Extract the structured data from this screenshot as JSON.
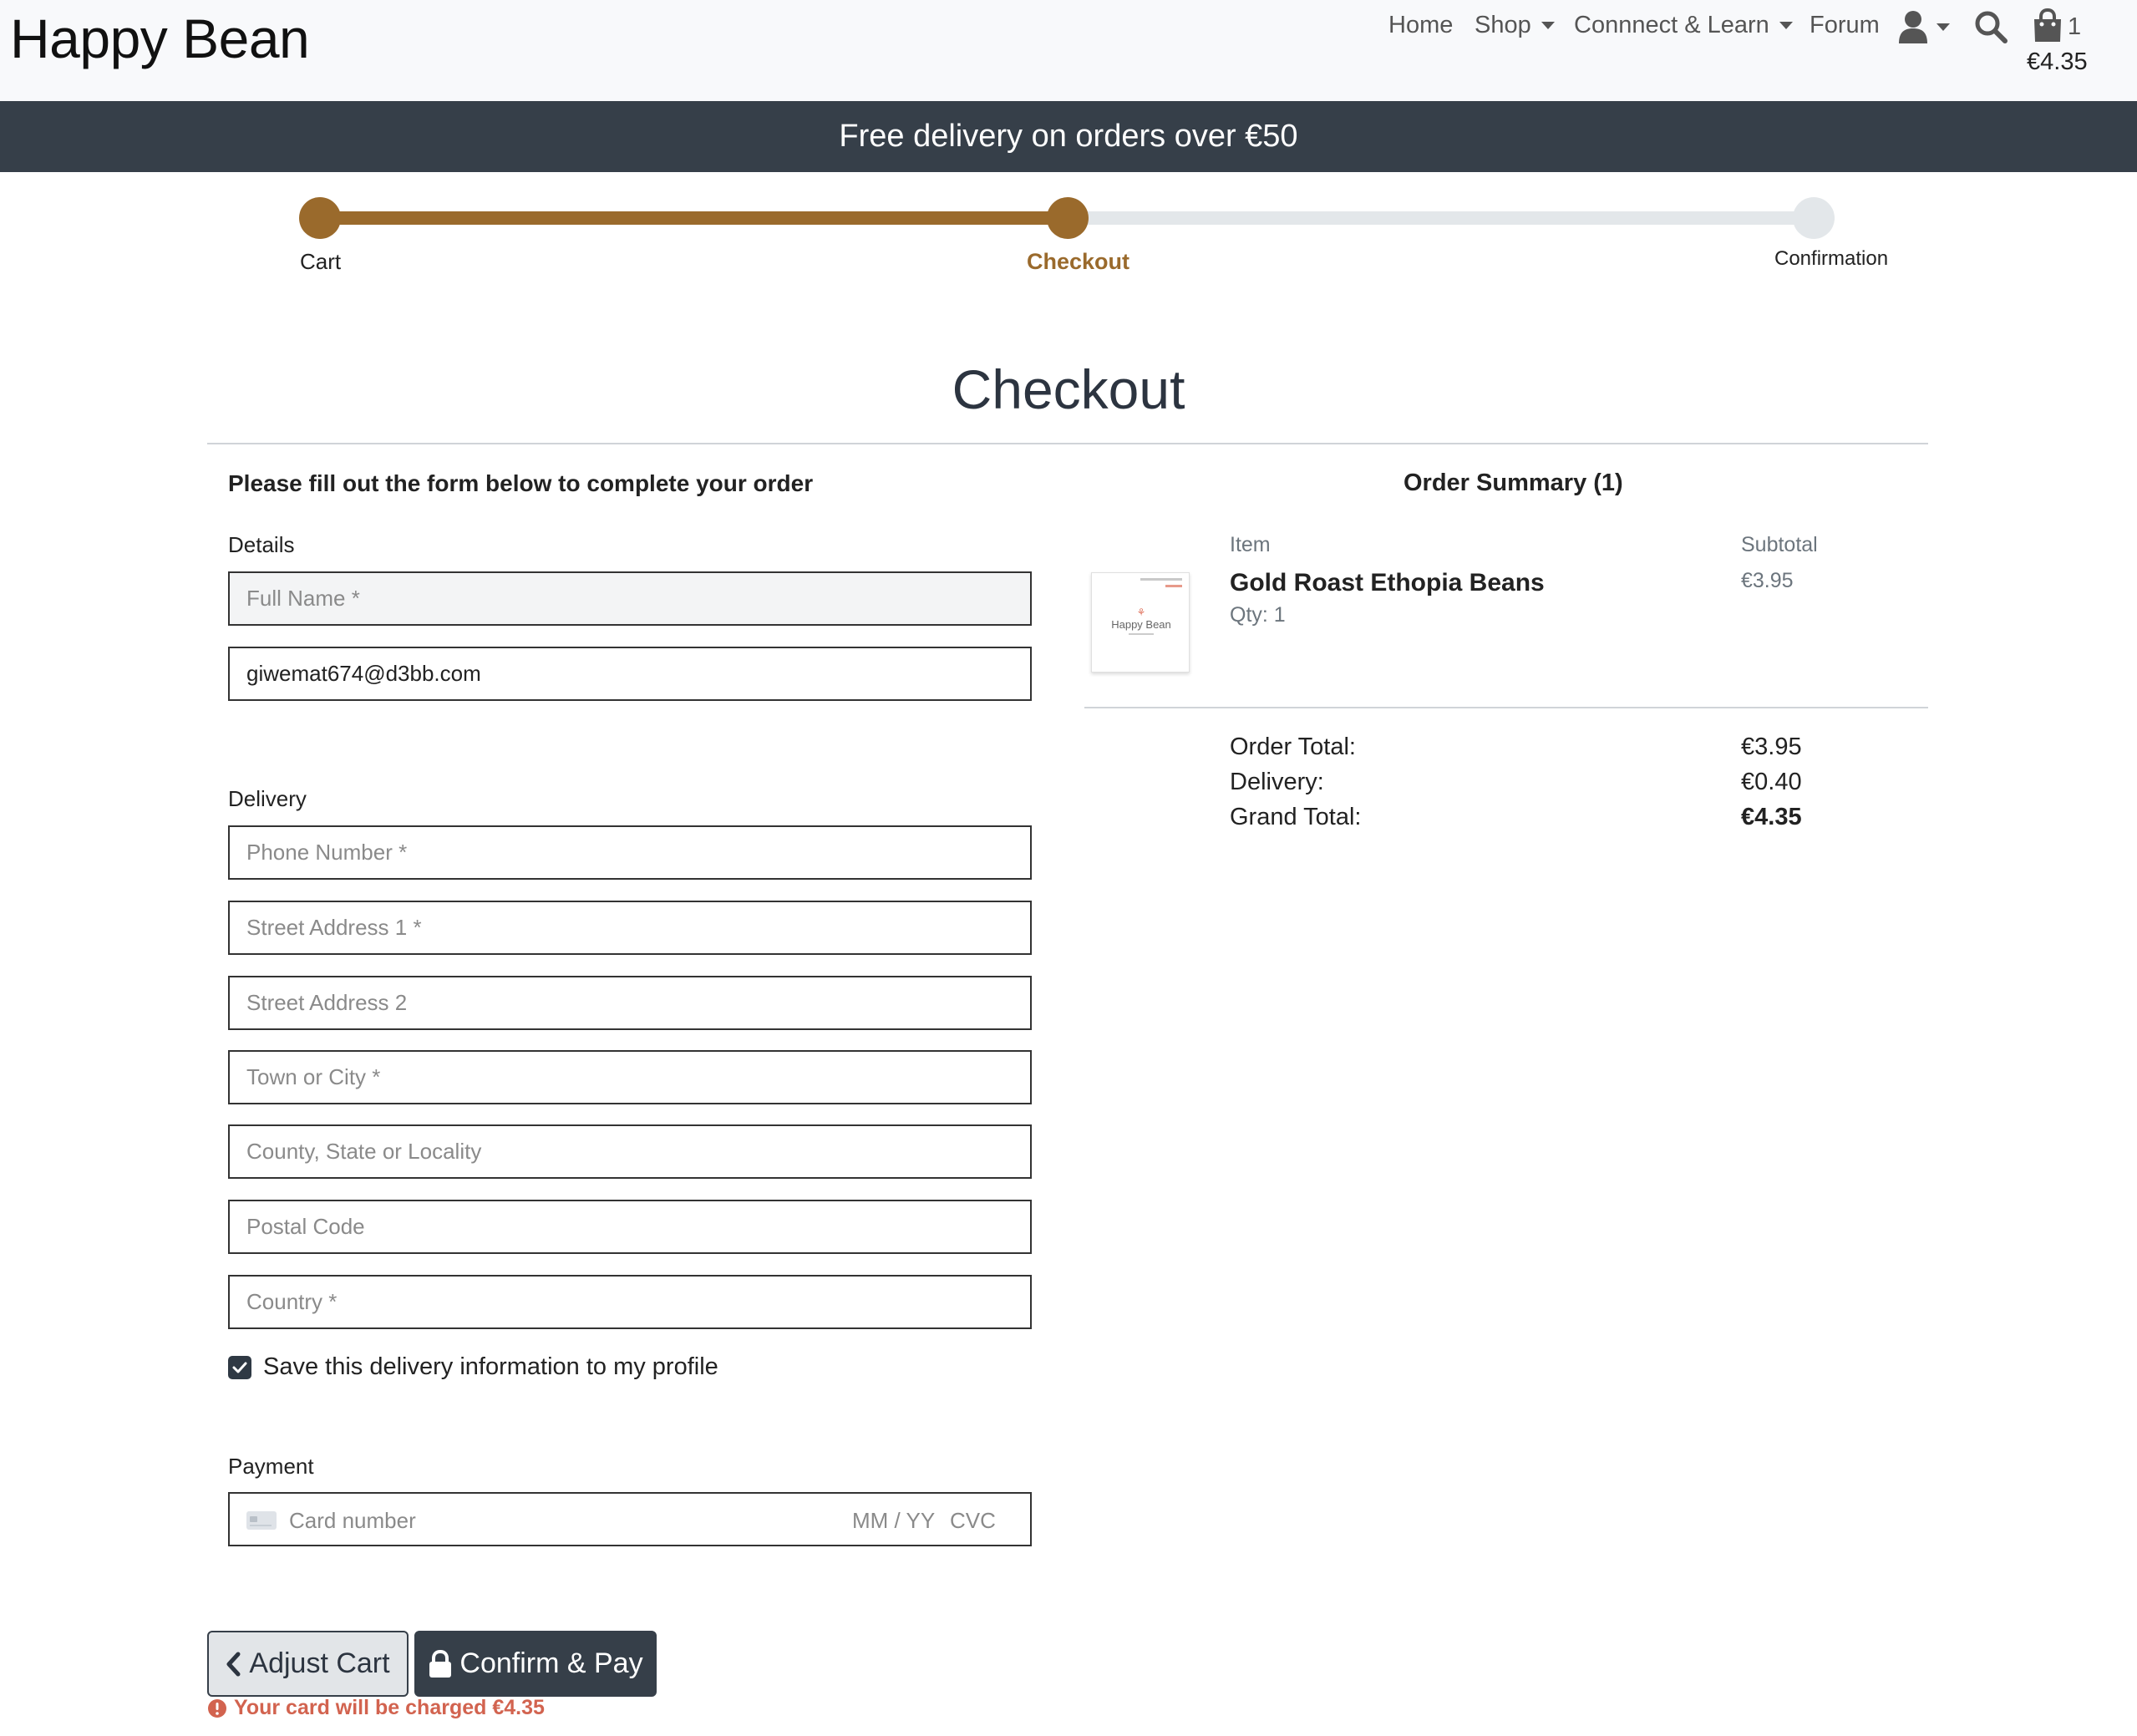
{
  "header": {
    "brand": "Happy Bean",
    "nav": {
      "home": "Home",
      "shop": "Shop",
      "connect": "Connnect & Learn",
      "forum": "Forum"
    },
    "cart_count": "1",
    "cart_total": "€4.35"
  },
  "banner": "Free delivery on orders over €50",
  "progress": {
    "steps": [
      "Cart",
      "Checkout",
      "Confirmation"
    ],
    "current_step": 2,
    "accent": "#9a6a2c",
    "inactive": "#e3e7ea"
  },
  "page_title": "Checkout",
  "form": {
    "intro": "Please fill out the form below to complete your order",
    "details_label": "Details",
    "full_name_placeholder": "Full Name *",
    "email_value": "giwemat674@d3bb.com",
    "delivery_label": "Delivery",
    "phone_placeholder": "Phone Number *",
    "street1_placeholder": "Street Address 1 *",
    "street2_placeholder": "Street Address 2",
    "town_placeholder": "Town or City *",
    "county_placeholder": "County, State or Locality",
    "postcode_placeholder": "Postal Code",
    "country_placeholder": "Country *",
    "save_info_label": "Save this delivery information to my profile",
    "save_info_checked": true,
    "payment_label": "Payment",
    "card_number_placeholder": "Card number",
    "card_expiry_placeholder": "MM / YY",
    "card_cvc_placeholder": "CVC",
    "adjust_cart": "Adjust Cart",
    "confirm_pay": "Confirm & Pay",
    "charge_notice": "Your card will be charged €4.35"
  },
  "summary": {
    "title": "Order Summary (1)",
    "col_item": "Item",
    "col_subtotal": "Subtotal",
    "item_name": "Gold Roast Ethopia Beans",
    "item_qty": "Qty: 1",
    "item_subtotal": "€3.95",
    "thumb_logo": "Happy Bean",
    "order_total_label": "Order Total:",
    "order_total": "€3.95",
    "delivery_label": "Delivery:",
    "delivery": "€0.40",
    "grand_total_label": "Grand Total:",
    "grand_total": "€4.35"
  }
}
